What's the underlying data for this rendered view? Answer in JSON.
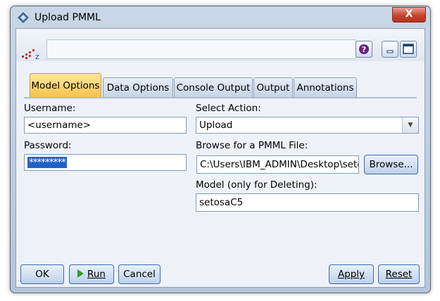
{
  "window": {
    "title": "Upload PMML",
    "close_label": "X"
  },
  "toolbar": {
    "logo_text": "z",
    "help_label": "?"
  },
  "tabs": [
    {
      "label": "Model Options",
      "active": true
    },
    {
      "label": "Data Options",
      "active": false
    },
    {
      "label": "Console Output",
      "active": false
    },
    {
      "label": "Output",
      "active": false
    },
    {
      "label": "Annotations",
      "active": false
    }
  ],
  "form": {
    "username_label": "Username:",
    "username_value": "<username>",
    "password_label": "Password:",
    "password_value": "*********",
    "action_label": "Select Action:",
    "action_value": "Upload",
    "browse_label": "Browse for a PMML File:",
    "file_path": "C:\\Users\\IBM_ADMIN\\Desktop\\setc",
    "browse_button": "Browse...",
    "model_label": "Model (only for Deleting):",
    "model_value": "setosaC5"
  },
  "buttons": {
    "ok": "OK",
    "run": "Run",
    "cancel": "Cancel",
    "apply": "Apply",
    "reset": "Reset"
  }
}
